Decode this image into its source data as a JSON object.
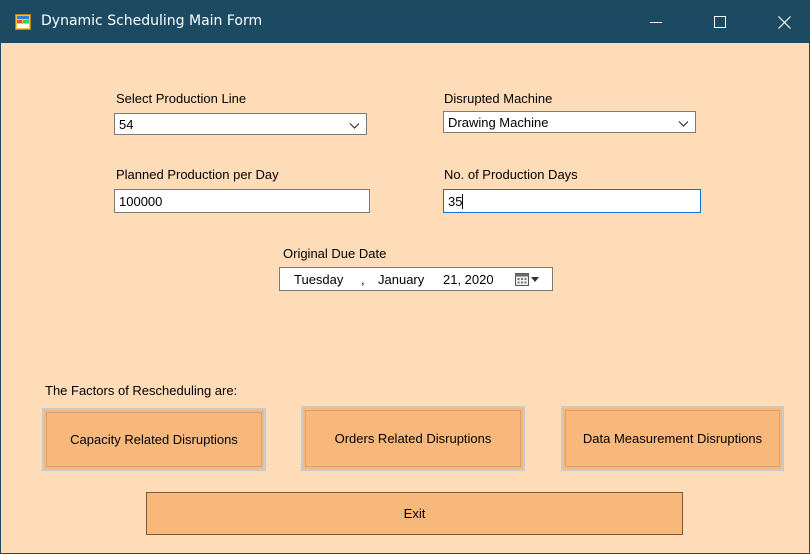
{
  "window": {
    "title": "Dynamic Scheduling Main Form",
    "icons": {
      "app": "app-form-icon",
      "minimize": "minimize-icon",
      "maximize": "maximize-icon",
      "close": "close-icon"
    }
  },
  "form": {
    "production_line": {
      "label": "Select Production Line",
      "value": "54"
    },
    "disrupted_machine": {
      "label": "Disrupted Machine",
      "value": "Drawing Machine"
    },
    "planned_production": {
      "label": "Planned Production per Day",
      "value": "100000"
    },
    "production_days": {
      "label": "No. of Production Days",
      "value": "35"
    },
    "due_date": {
      "label": "Original Due Date",
      "weekday": "Tuesday",
      "sep": ",",
      "month": "January",
      "day_year": "21, 2020"
    }
  },
  "factors": {
    "label": "The Factors of Rescheduling are:",
    "buttons": [
      {
        "label": "Capacity Related Disruptions"
      },
      {
        "label": "Orders Related Disruptions"
      },
      {
        "label": "Data Measurement Disruptions"
      }
    ]
  },
  "exit_label": "Exit",
  "colors": {
    "titlebar": "#1c4a63",
    "background": "#ffdcb8",
    "button": "#f8b87c"
  }
}
